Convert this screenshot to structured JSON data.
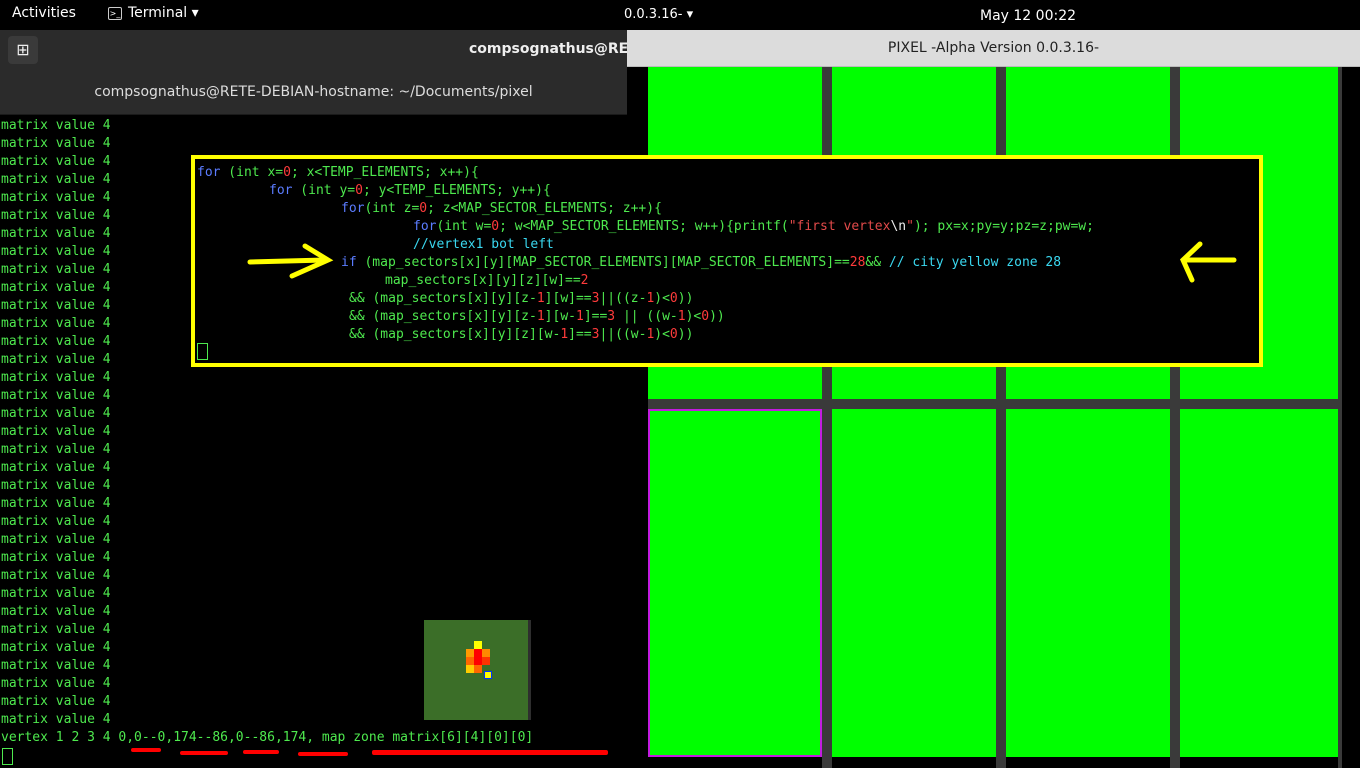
{
  "topbar": {
    "activities": "Activities",
    "app_menu": "Terminal",
    "second_app_menu": "0.0.3.16-",
    "clock": "May 12  00:22"
  },
  "terminal": {
    "window_title": "compsognathus@RETE-",
    "subtitle": "compsognathus@RETE-DEBIAN-hostname: ~/Documents/pixel",
    "matrix_line": "matrix value 4",
    "matrix_line_count": 34,
    "status_prefix": "vertex 1 2 3 4 ",
    "status_coords": "0,0--0,174--86,0--86,174,",
    "status_zone": "map zone matrix[6][4][0][0]"
  },
  "pixel_window": {
    "title": "PIXEL -Alpha Version 0.0.3.16-"
  },
  "code_overlay": {
    "line1_a": "for",
    "line1_b": " (int x=",
    "line1_c": "0",
    "line1_d": "; x<TEMP_ELEMENTS; x++){",
    "line2_a": "for",
    "line2_b": " (int y=",
    "line2_c": "0",
    "line2_d": "; y<TEMP_ELEMENTS; y++){",
    "line3_a": "for",
    "line3_b": "(int z=",
    "line3_c": "0",
    "line3_d": "; z<MAP_SECTOR_ELEMENTS; z++){",
    "line4_a": "for",
    "line4_b": "(int w=",
    "line4_c": "0",
    "line4_d": "; w<MAP_SECTOR_ELEMENTS; w++){printf(",
    "line4_e": "\"first vertex",
    "line4_f": "\\n",
    "line4_g": "\"",
    "line4_h": "); px=x;py=y;pz=z;pw=w;",
    "line5": "//vertex1 bot left",
    "line6_a": "if",
    "line6_b": " (map_sectors[x][y][MAP_SECTOR_ELEMENTS][MAP_SECTOR_ELEMENTS]==",
    "line6_c": "28",
    "line6_d": "&& ",
    "line6_e": "// city yellow zone 28",
    "line7_a": "map_sectors[x][y][z][w]==",
    "line7_b": "2",
    "line8_a": "&& (map_sectors[x][y][z-",
    "line8_b": "1",
    "line8_c": "][w]==",
    "line8_d": "3",
    "line8_e": "||((z-",
    "line8_f": "1",
    "line8_g": ")<",
    "line8_h": "0",
    "line8_i": "))",
    "line9_a": "&& (map_sectors[x][y][z-",
    "line9_b": "1",
    "line9_c": "][w-",
    "line9_d": "1",
    "line9_e": "]==",
    "line9_f": "3",
    "line9_g": " || ((w-",
    "line9_h": "1",
    "line9_i": ")<",
    "line9_j": "0",
    "line9_k": "))",
    "line10_a": "&& (map_sectors[x][y][z][w-",
    "line10_b": "1",
    "line10_c": "]==",
    "line10_d": "3",
    "line10_e": "||((w-",
    "line10_f": "1",
    "line10_g": ")<",
    "line10_h": "0",
    "line10_i": "))"
  },
  "colors": {
    "terminal_text": "#4ee94e",
    "highlight_frame": "#ffff00",
    "grid_cell": "#00ff00",
    "grid_gap": "#3a3a3a",
    "selected_outline": "#c31ce0",
    "annotation_red": "#ff0000"
  }
}
